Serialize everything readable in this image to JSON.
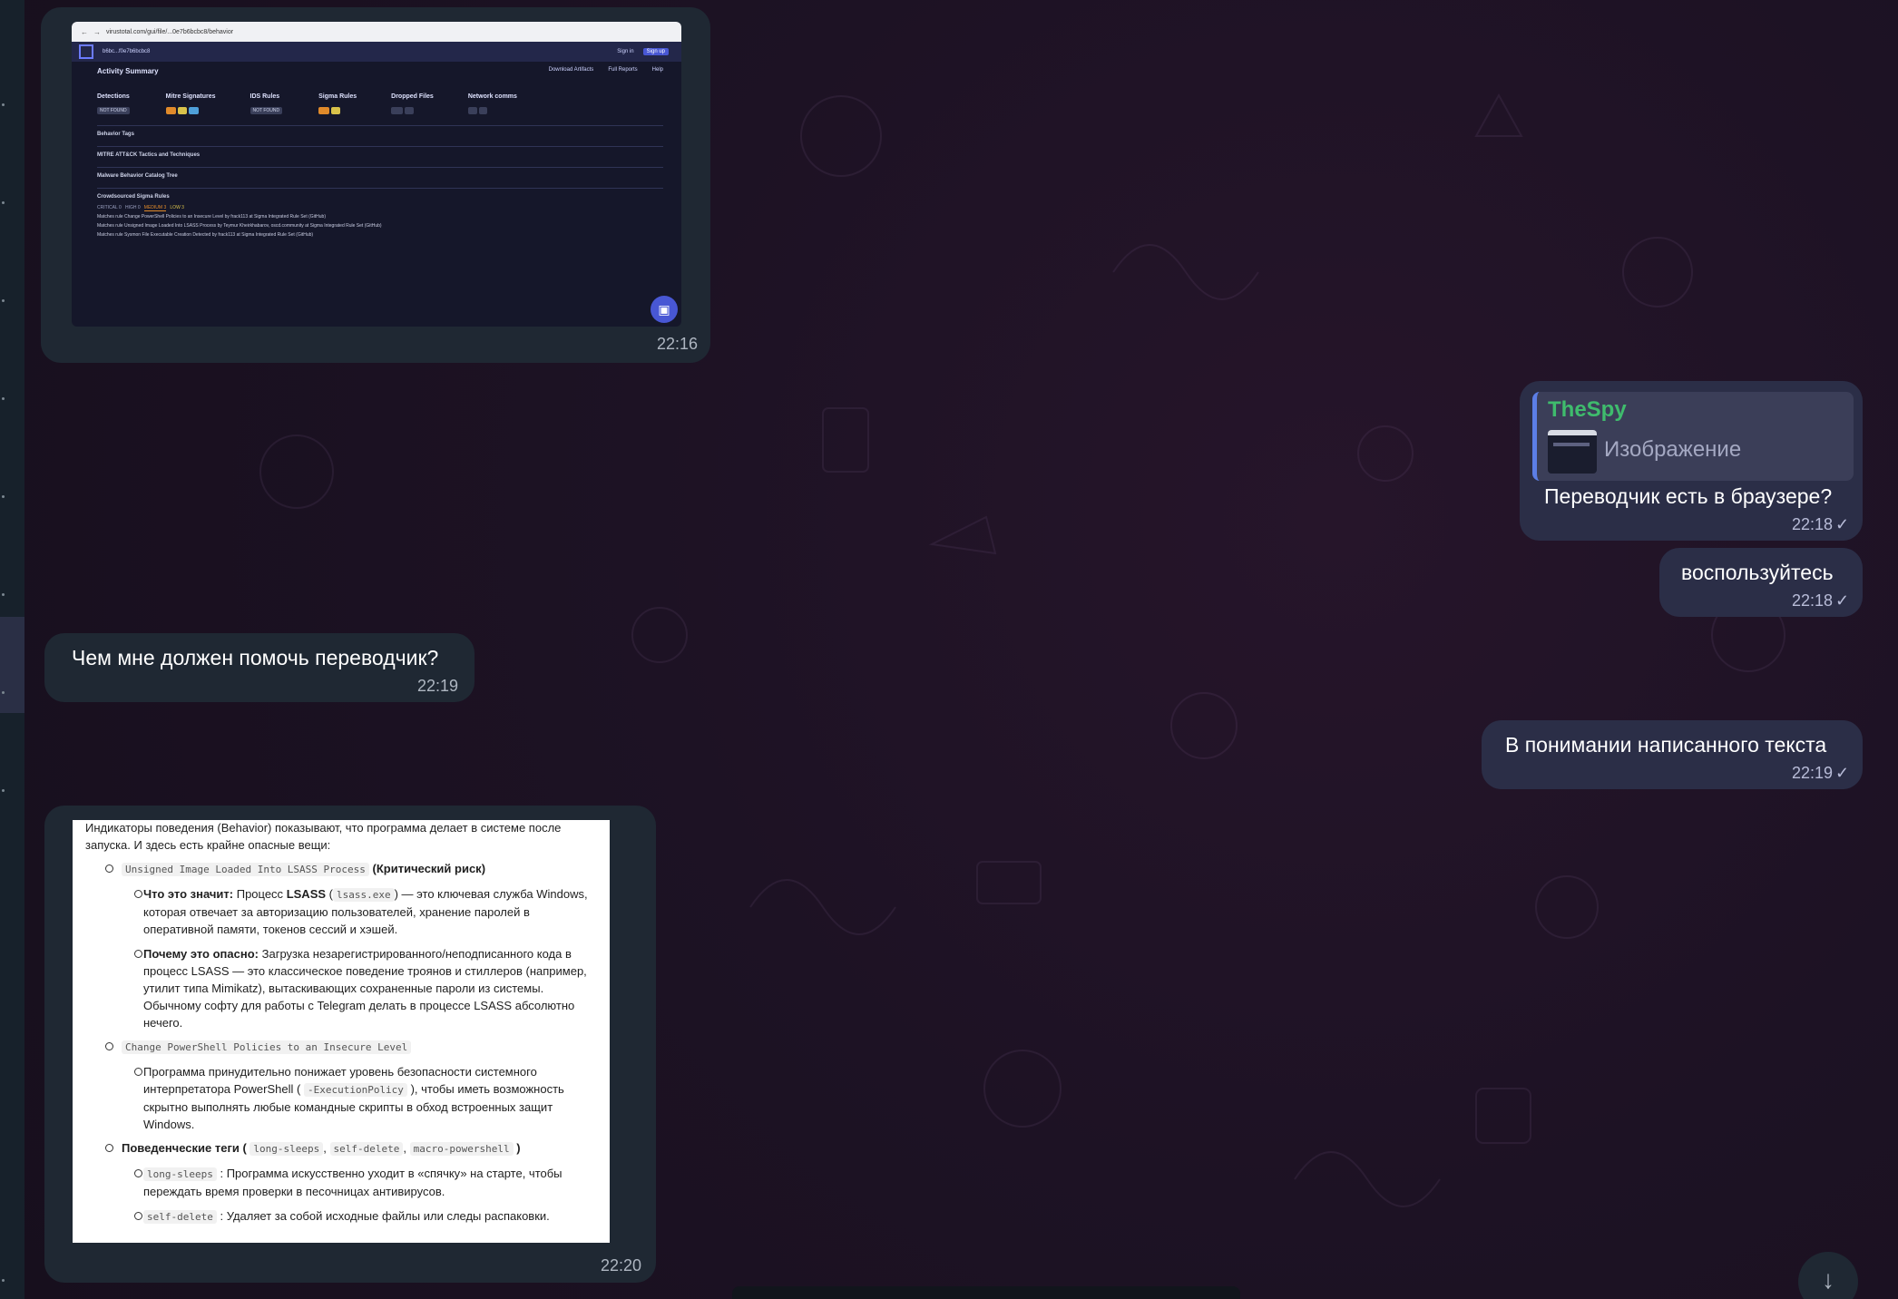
{
  "messages": {
    "m1": {
      "time": "22:16"
    },
    "m2": {
      "reply_sender": "TheSpy",
      "reply_label": "Изображение",
      "text": "Переводчик есть в браузере?",
      "time": "22:18"
    },
    "m3": {
      "text": "воспользуйтесь",
      "time": "22:18"
    },
    "m4": {
      "text": "Чем мне должен помочь переводчик?",
      "time": "22:19"
    },
    "m5": {
      "text": "В понимании написанного текста",
      "time": "22:19"
    },
    "m6": {
      "time": "22:20"
    }
  },
  "shot": {
    "url": "virustotal.com/gui/file/...0e7b6bcbc8/behavior",
    "hash": "b6bc...f0e7b6bcbc8",
    "signin": "Sign in",
    "signup": "Sign up",
    "title": "Activity Summary",
    "menus": [
      "Download Artifacts",
      "Full Reports",
      "Help"
    ],
    "cols": [
      "Detections",
      "Mitre Signatures",
      "IDS Rules",
      "Sigma Rules",
      "Dropped Files",
      "Network comms"
    ],
    "not_found": "NOT FOUND",
    "sections": [
      "Behavior Tags",
      "MITRE ATT&CK Tactics and Techniques",
      "Malware Behavior Catalog Tree",
      "Crowdsourced Sigma Rules"
    ],
    "tabs": [
      "CRITICAL 0",
      "HIGH 0",
      "MEDIUM 3",
      "LOW 3"
    ],
    "rules": [
      "Matches rule Change PowerShell Policies to an Insecure Level by frack113 at Sigma Integrated Rule Set (GitHub)",
      "Matches rule Unsigned Image Loaded Into LSASS Process by Teymur Kheirkhabarov, oscd.community at Sigma Integrated Rule Set (GitHub)",
      "Matches rule Sysmon File Executable Creation Detected by frack113 at Sigma Integrated Rule Set (GitHub)"
    ]
  },
  "doc": {
    "intro": "Индикаторы поведения (Behavior) показывают, что программа делает в системе после запуска. И здесь есть крайне опасные вещи:",
    "i1_code": "Unsigned Image Loaded Into LSASS Process",
    "i1_tail": "(Критический риск)",
    "i1a_bold": "Что это значит:",
    "i1a_text1": "Процесс",
    "i1a_lsass": "LSASS",
    "i1a_code": "lsass.exe",
    "i1a_text2": "— это ключевая служба Windows, которая отвечает за авторизацию пользователей, хранение паролей в оперативной памяти, токенов сессий и хэшей.",
    "i1b_bold": "Почему это опасно:",
    "i1b_text": "Загрузка незарегистрированного/неподписанного кода в процесс LSASS — это классическое поведение троянов и стиллеров (например, утилит типа Mimikatz), вытаскивающих сохраненные пароли из системы. Обычному софту для работы с Telegram делать в процессе LSASS абсолютно нечего.",
    "i2_code": "Change PowerShell Policies to an Insecure Level",
    "i2a_text1": "Программа принудительно понижает уровень безопасности системного интерпретатора PowerShell (",
    "i2a_code": "-ExecutionPolicy",
    "i2a_text2": "), чтобы иметь возможность скрытно выполнять любые командные скрипты в обход встроенных защит Windows.",
    "i3_bold": "Поведенческие теги (",
    "i3_c1": "long-sleeps",
    "i3_c2": "self-delete",
    "i3_c3": "macro-powershell",
    "i3_close": ")",
    "i3a_code": "long-sleeps",
    "i3a_text": ": Программа искусственно уходит в «спячку» на старте, чтобы переждать время проверки в песочницах антивирусов.",
    "i3b_code": "self-delete",
    "i3b_text": ": Удаляет за собой исходные файлы или следы распаковки."
  },
  "icons": [
    "check-icon",
    "scroll-down-icon",
    "chat-fab-icon"
  ],
  "colors": {
    "incoming": "#1f2833",
    "outgoing": "#2b2e47",
    "reply_name": "#3fbc6d",
    "reply_bar": "#5c7ee6"
  }
}
